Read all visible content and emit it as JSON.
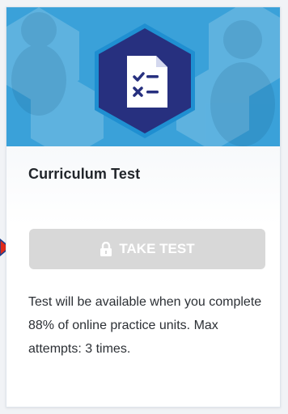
{
  "card": {
    "title": "Curriculum Test",
    "badge_icon": "checklist-document-icon",
    "button": {
      "label": "TAKE TEST",
      "icon": "lock-icon",
      "state": "disabled"
    },
    "description": "Test will be available when you complete 88% of online practice units. Max attempts: 3 times."
  },
  "colors": {
    "banner": "#3aa1d9",
    "badge_fill": "#27307f",
    "badge_outer": "#1f8fd1",
    "button_disabled": "#d8d8d8",
    "arrow": "#e02a1a"
  }
}
